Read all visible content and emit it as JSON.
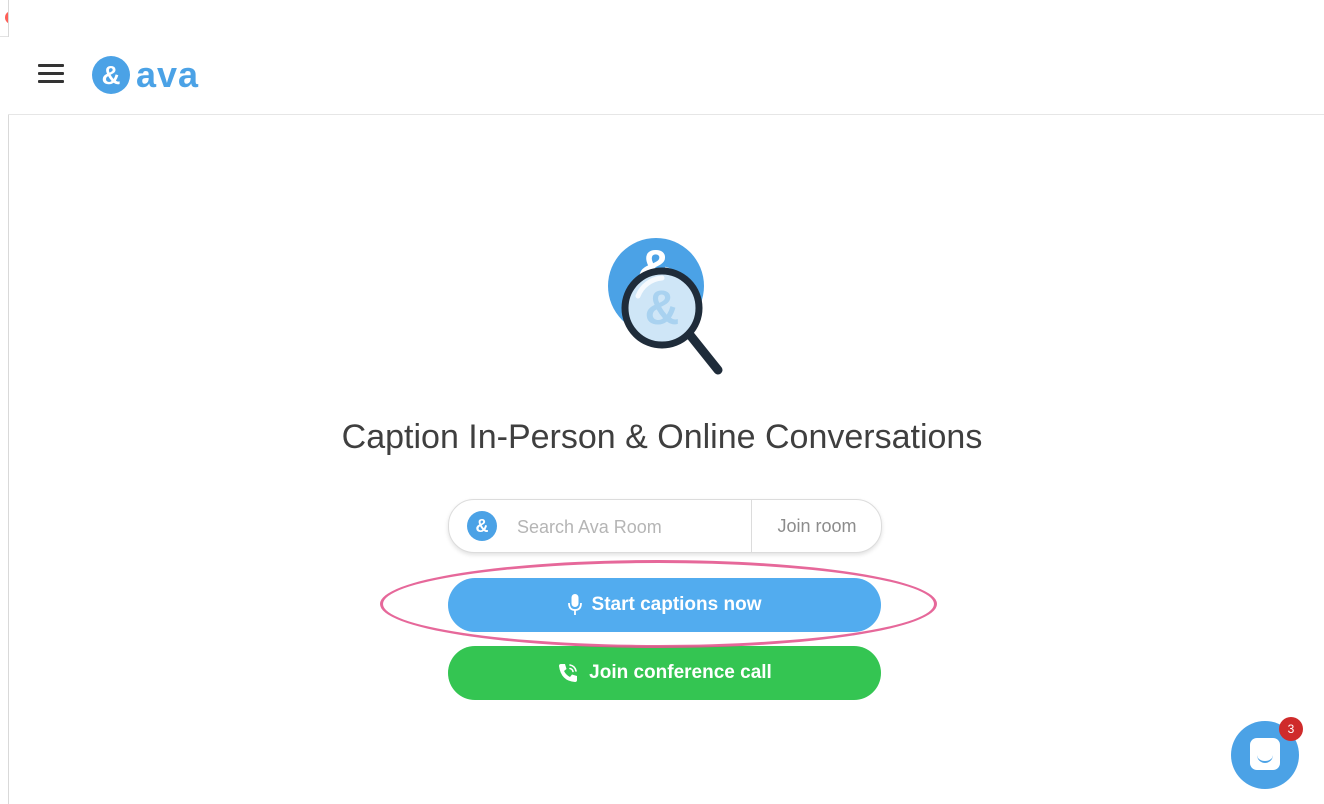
{
  "window": {
    "controls": [
      "close",
      "minimize",
      "zoom"
    ]
  },
  "header": {
    "menu_icon": "hamburger-icon",
    "logo_mark": "&",
    "logo_text": "ava"
  },
  "main": {
    "hero_icon": "ava-search-magnifier-icon",
    "headline": "Caption In-Person & Online Conversations",
    "search": {
      "icon_text": "&",
      "placeholder": "Search Ava Room",
      "join_label": "Join room"
    },
    "start_button": {
      "label": "Start captions now",
      "icon": "microphone-icon"
    },
    "conference_button": {
      "label": "Join conference call",
      "icon": "phone-icon"
    }
  },
  "chat_widget": {
    "icon": "chat-bubble-icon",
    "badge_count": "3"
  },
  "colors": {
    "brand_blue": "#4ba2e6",
    "start_button": "#52acef",
    "conference_button": "#34c552",
    "annotation": "#e3588f",
    "badge": "#cf2b2b"
  }
}
